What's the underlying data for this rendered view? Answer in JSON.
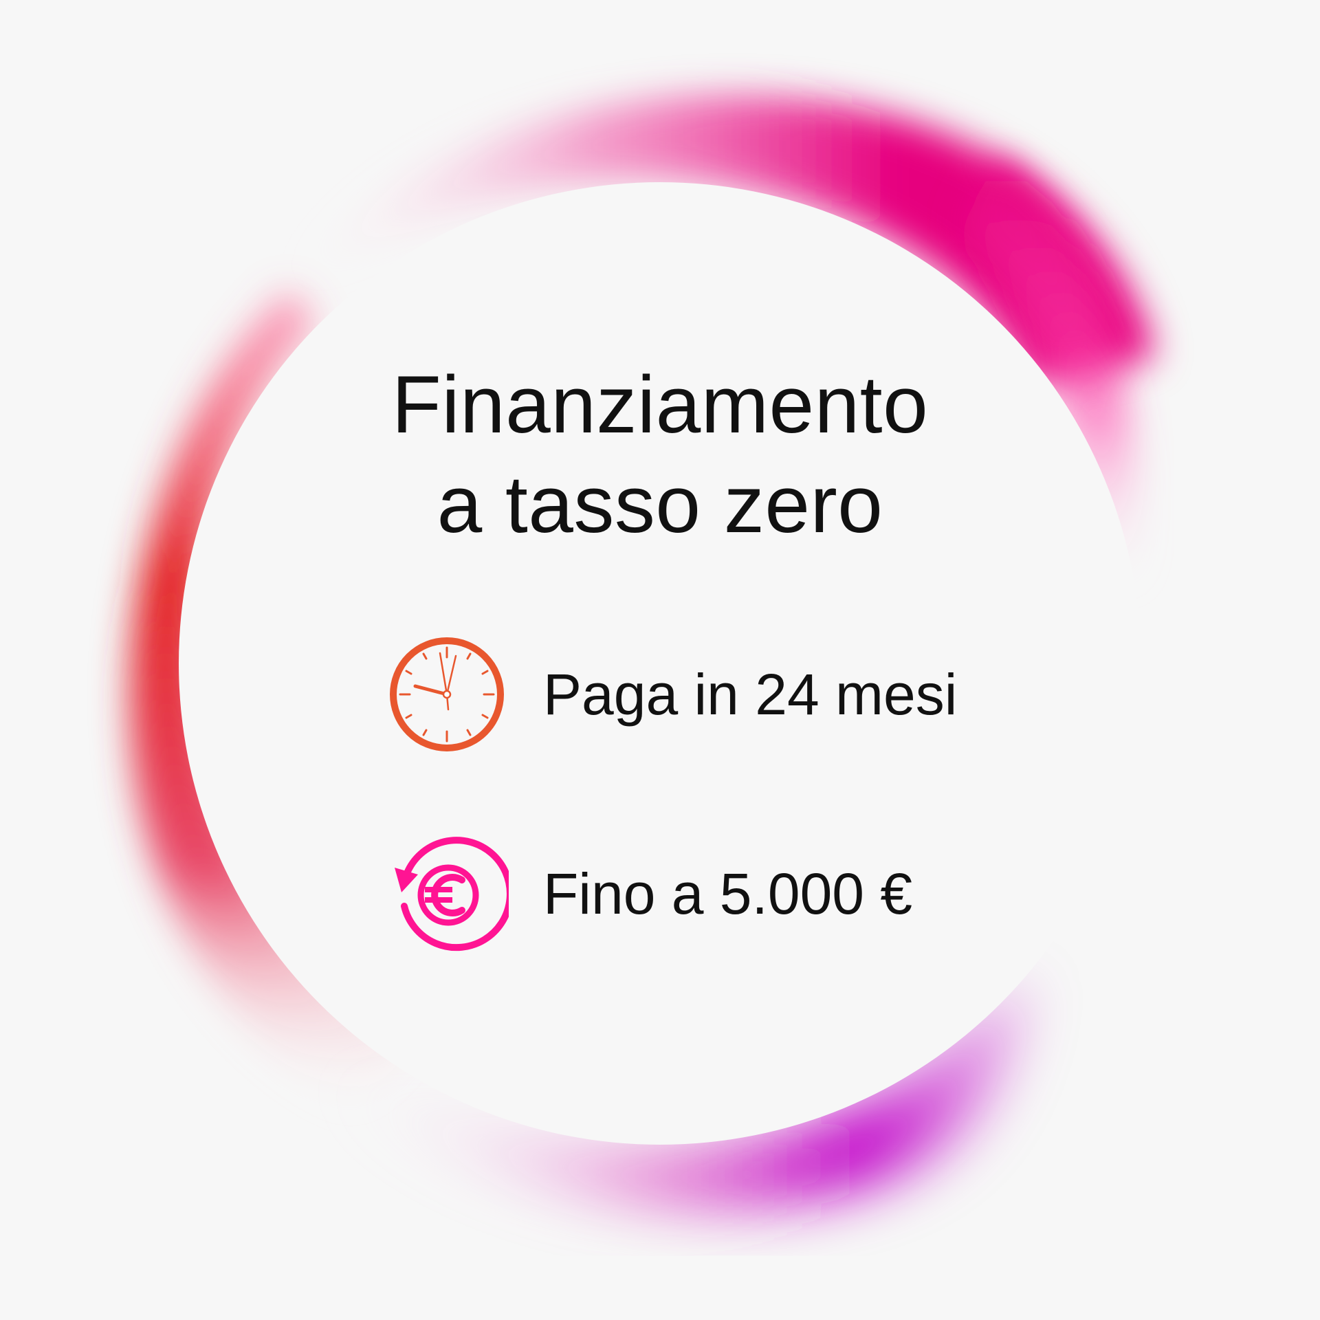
{
  "title": {
    "line1": "Finanziamento",
    "line2": "a tasso zero"
  },
  "features": [
    {
      "icon": "clock-icon",
      "label": "Paga in 24 mesi",
      "color": "#e8572e"
    },
    {
      "icon": "euro-cycle-icon",
      "label": "Fino a 5.000 €",
      "color": "#ff1493"
    }
  ],
  "colors": {
    "background": "#f7f7f7",
    "ring_magenta": "#e6007e",
    "ring_red": "#e32222",
    "ring_violet": "#c000c8",
    "text": "#111111"
  }
}
